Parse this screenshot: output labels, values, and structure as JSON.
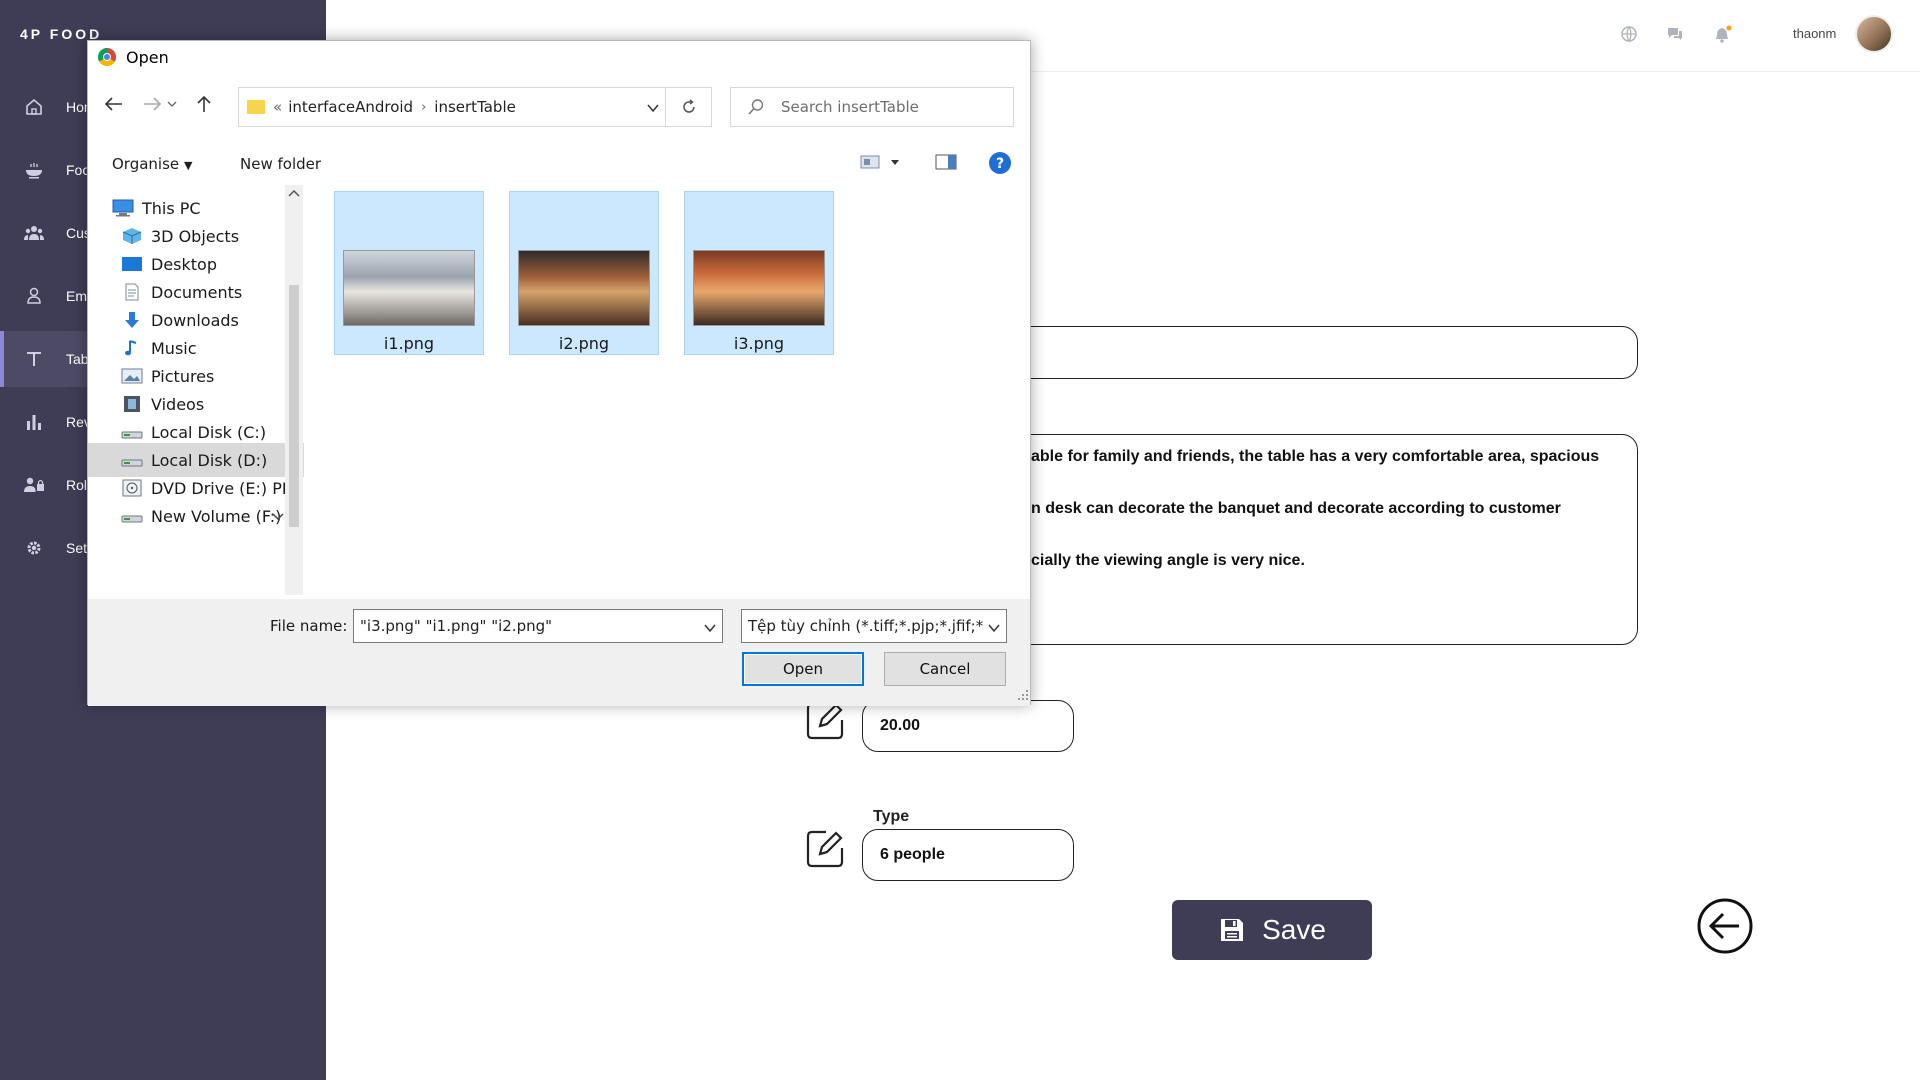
{
  "app": {
    "brand": "4P FOOD"
  },
  "sidebar": {
    "items": [
      {
        "label": "Home",
        "icon": "home-icon"
      },
      {
        "label": "Food",
        "icon": "food-bowl-icon"
      },
      {
        "label": "Customer",
        "icon": "users-icon"
      },
      {
        "label": "Employee",
        "icon": "person-icon"
      },
      {
        "label": "Table",
        "icon": "text-icon",
        "active": true
      },
      {
        "label": "Revenue",
        "icon": "bar-chart-icon"
      },
      {
        "label": "Role",
        "icon": "user-lock-icon"
      },
      {
        "label": "Settings",
        "icon": "gear-icon"
      }
    ]
  },
  "topbar": {
    "username": "thaonm",
    "icons": [
      "globe-icon",
      "chat-icon",
      "bell-icon"
    ]
  },
  "form": {
    "description_lines": [
      "able for family and friends,  the table has a very comfortable area, spacious",
      "n desk can decorate the banquet  and decorate according to customer",
      "cially the viewing angle is very nice."
    ],
    "price_value": "20.00",
    "type_label": "Type",
    "type_value": "6 people",
    "save_label": "Save"
  },
  "dialog": {
    "title": "Open",
    "path": [
      "«",
      "interfaceAndroid",
      "insertTable"
    ],
    "search_placeholder": "Search insertTable",
    "organise_label": "Organise",
    "new_folder_label": "New folder",
    "tree": [
      {
        "label": "This PC",
        "icon": "computer-icon"
      },
      {
        "label": "3D Objects",
        "icon": "cube-icon"
      },
      {
        "label": "Desktop",
        "icon": "desktop-icon"
      },
      {
        "label": "Documents",
        "icon": "document-icon"
      },
      {
        "label": "Downloads",
        "icon": "download-arrow-icon"
      },
      {
        "label": "Music",
        "icon": "music-note-icon"
      },
      {
        "label": "Pictures",
        "icon": "picture-icon"
      },
      {
        "label": "Videos",
        "icon": "film-icon"
      },
      {
        "label": "Local Disk (C:)",
        "icon": "drive-icon"
      },
      {
        "label": "Local Disk (D:)",
        "icon": "drive-icon",
        "selected": true
      },
      {
        "label": "DVD Drive (E:) PF",
        "icon": "dvd-icon"
      },
      {
        "label": "New Volume (F:)",
        "icon": "drive-icon"
      }
    ],
    "files": [
      {
        "name": "i1.png"
      },
      {
        "name": "i2.png"
      },
      {
        "name": "i3.png"
      }
    ],
    "file_name_label": "File name:",
    "file_name_value": "\"i3.png\" \"i1.png\" \"i2.png\"",
    "file_type_value": "Tệp tùy chỉnh (*.tiff;*.pjp;*.jfif;*",
    "open_label": "Open",
    "cancel_label": "Cancel"
  },
  "colors": {
    "sidebar_bg": "#3f3d56",
    "accent": "#0078d7",
    "selection": "#cce8ff"
  }
}
